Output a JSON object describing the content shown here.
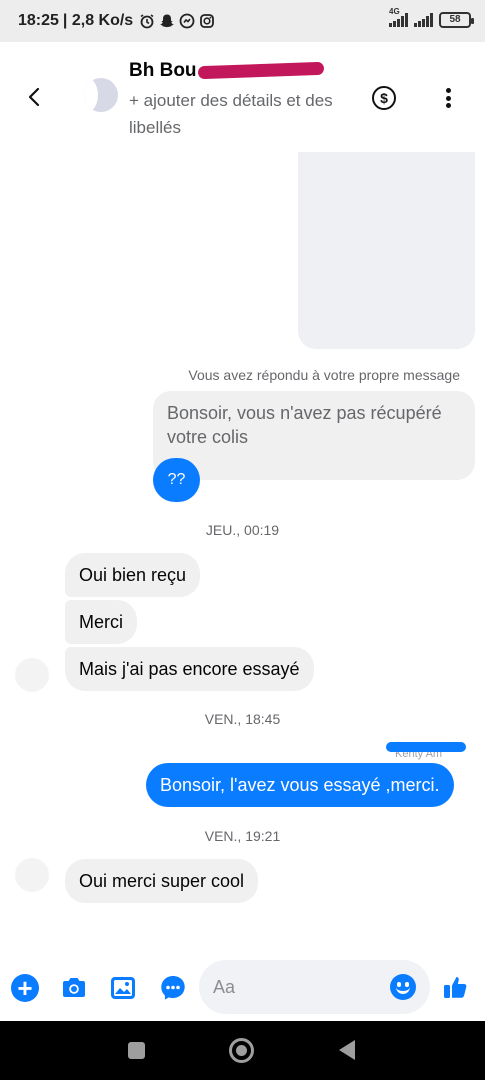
{
  "status_bar": {
    "time": "18:25",
    "speed": "| 2,8 Ko/s",
    "network": "4G",
    "battery": "58"
  },
  "header": {
    "contact_name": "Bh Bou",
    "subtitle": "+ ajouter des détails et des libellés"
  },
  "conversation": {
    "reply_note": "Vous avez répondu à votre propre message",
    "quoted_message": "Bonsoir, vous n'avez pas récupéré votre colis",
    "reply_message": "??",
    "timestamps": [
      "JEU., 00:19",
      "VEN., 18:45",
      "VEN., 19:21"
    ],
    "incoming_1": [
      "Oui bien reçu",
      "Merci",
      "Mais j'ai pas encore essayé"
    ],
    "seen_label": "Kenty Am",
    "outgoing_1": "Bonsoir, l'avez vous essayé ,merci.",
    "incoming_2": "Oui merci super cool"
  },
  "composer": {
    "placeholder": "Aa"
  },
  "icons": [
    "back-arrow-icon",
    "avatar-icon",
    "dollar-icon",
    "more-vertical-icon",
    "plus-icon",
    "camera-icon",
    "image-icon",
    "chat-bubble-icon",
    "emoji-icon",
    "thumbs-up-icon"
  ],
  "colors": {
    "accent": "#0a7cff",
    "incoming_bubble": "#f0f0f0",
    "redaction": "#c2185b"
  }
}
